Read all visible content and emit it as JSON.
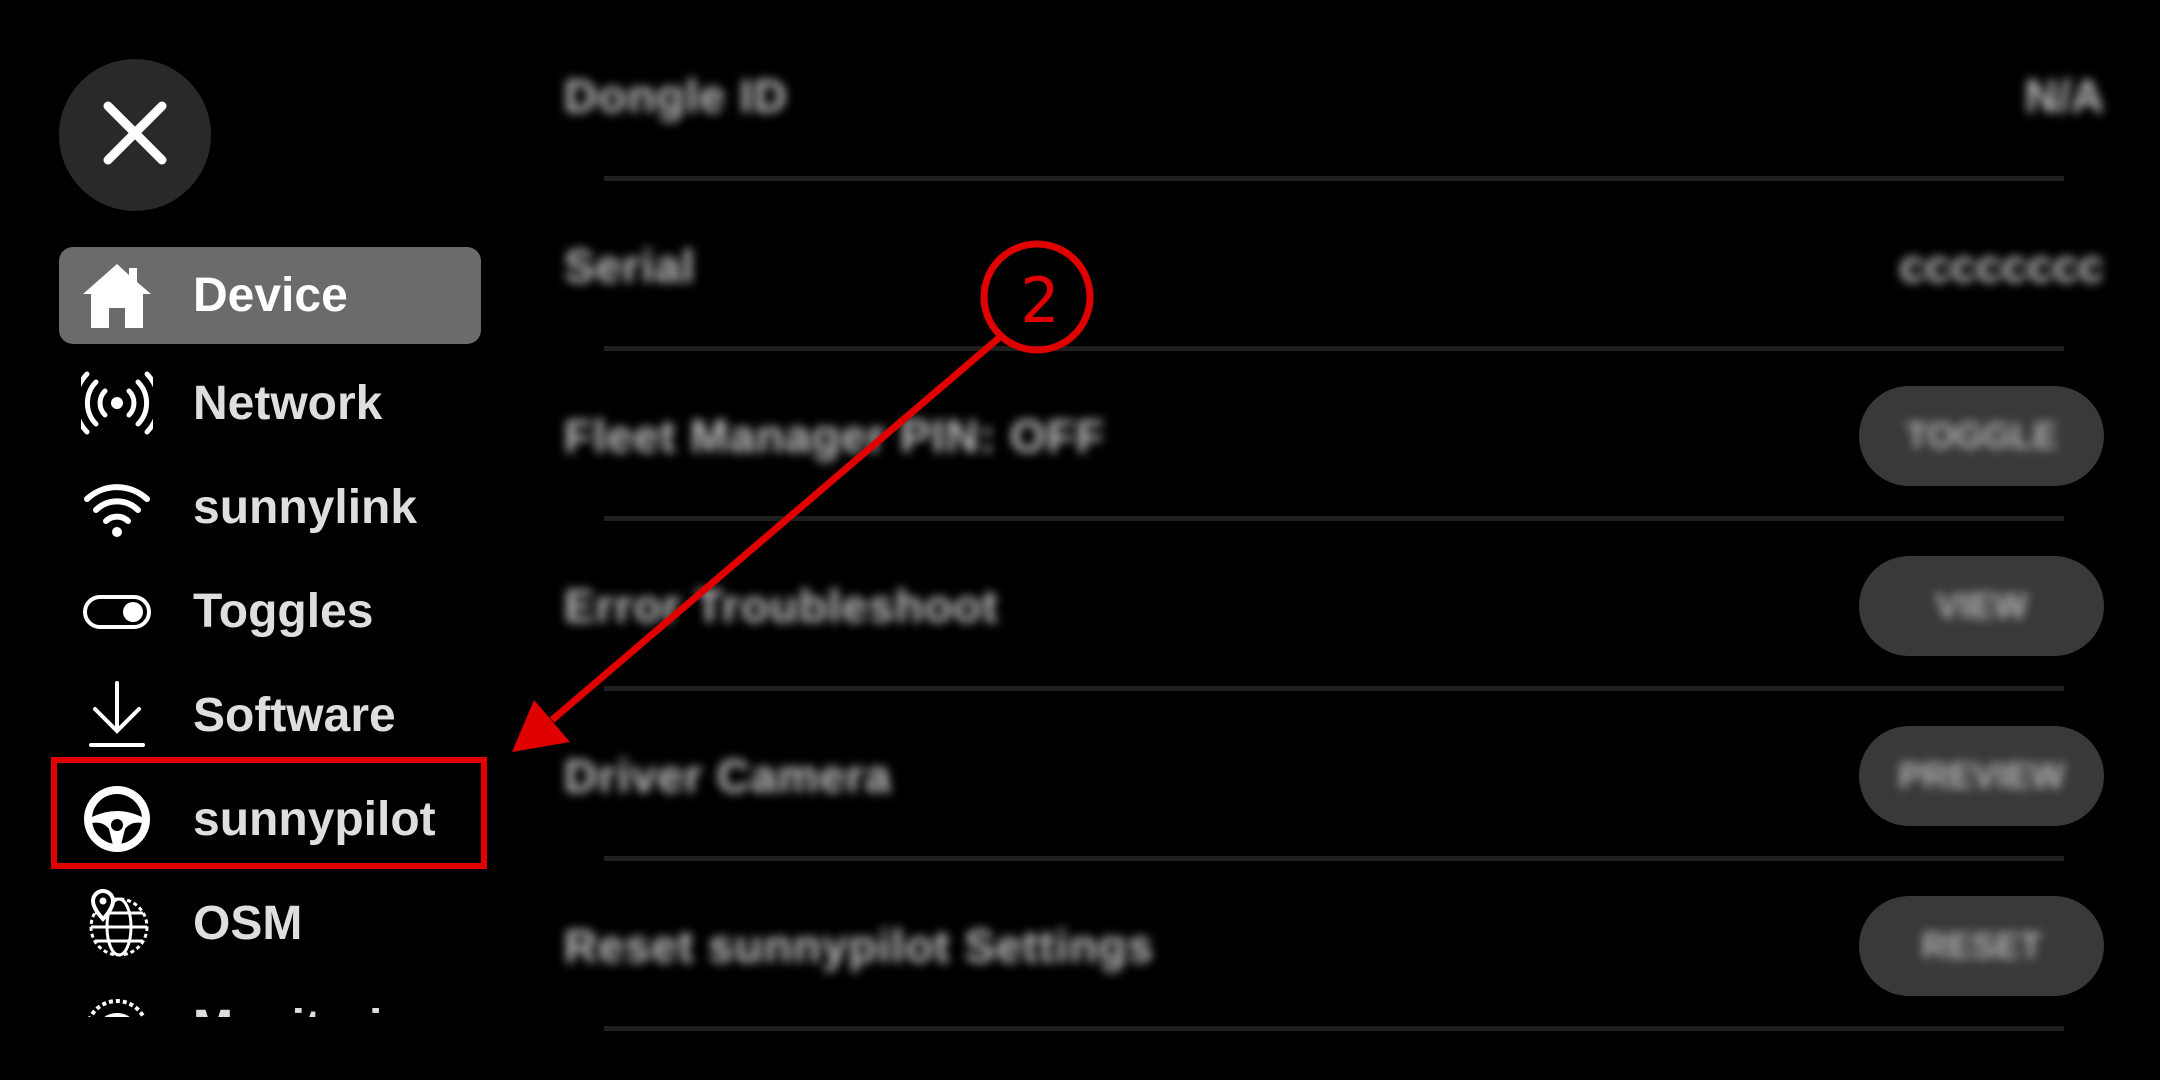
{
  "sidebar": {
    "close_icon": "close-icon",
    "items": [
      {
        "label": "Device",
        "icon": "home-icon",
        "active": true
      },
      {
        "label": "Network",
        "icon": "broadcast-icon",
        "active": false
      },
      {
        "label": "sunnylink",
        "icon": "wifi-icon",
        "active": false
      },
      {
        "label": "Toggles",
        "icon": "toggle-icon",
        "active": false
      },
      {
        "label": "Software",
        "icon": "download-icon",
        "active": false
      },
      {
        "label": "sunnypilot",
        "icon": "steering-wheel-icon",
        "active": false
      },
      {
        "label": "OSM",
        "icon": "globe-pin-icon",
        "active": false
      },
      {
        "label": "Monitoring",
        "icon": "monitoring-icon",
        "active": false
      }
    ]
  },
  "device_panel": {
    "rows": [
      {
        "title": "Dongle ID",
        "value": "N/A"
      },
      {
        "title": "Serial",
        "value": "cccccccc"
      },
      {
        "title": "Fleet Manager PIN: OFF",
        "button": "TOGGLE"
      },
      {
        "title": "Error Troubleshoot",
        "button": "VIEW"
      },
      {
        "title": "Driver Camera",
        "button": "PREVIEW"
      },
      {
        "title": "Reset sunnypilot Settings",
        "button": "RESET"
      }
    ]
  },
  "annotation": {
    "step_number": "2",
    "color": "#e00000"
  }
}
